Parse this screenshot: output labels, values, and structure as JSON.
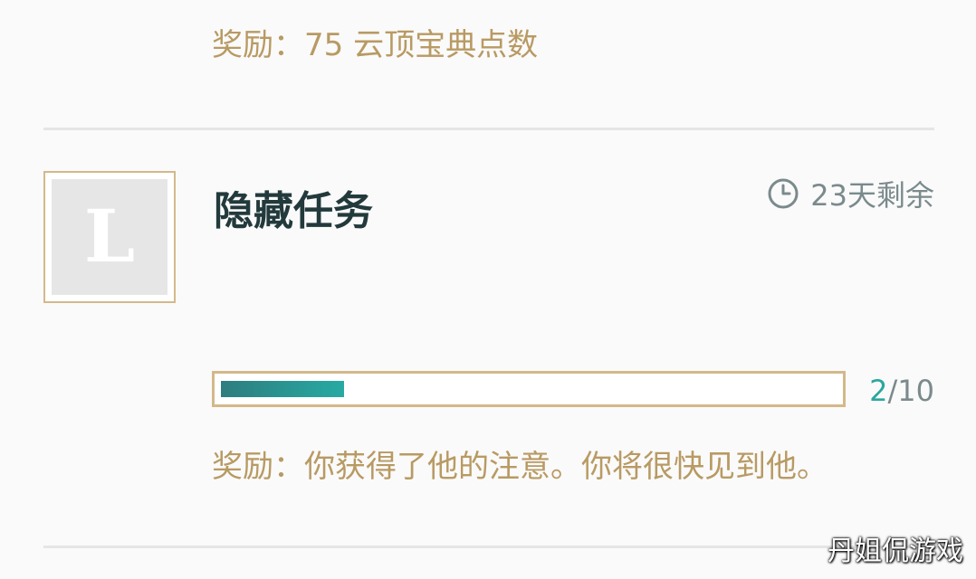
{
  "previous_mission": {
    "reward_text": "奖励：75 云顶宝典点数"
  },
  "mission": {
    "icon_letter": "L",
    "title": "隐藏任务",
    "time_icon": "clock-icon",
    "time_remaining": "23天剩余",
    "progress": {
      "current": "2",
      "separator": "/",
      "total": "10",
      "fraction": 0.2
    },
    "reward_text": "奖励：你获得了他的注意。你将很快见到他。"
  },
  "watermark": "丹姐侃游戏",
  "colors": {
    "gold_text": "#b89a63",
    "gold_border": "#d3b98a",
    "title": "#233a3c",
    "muted": "#7b8a8c",
    "accent_teal": "#2aa79e"
  }
}
